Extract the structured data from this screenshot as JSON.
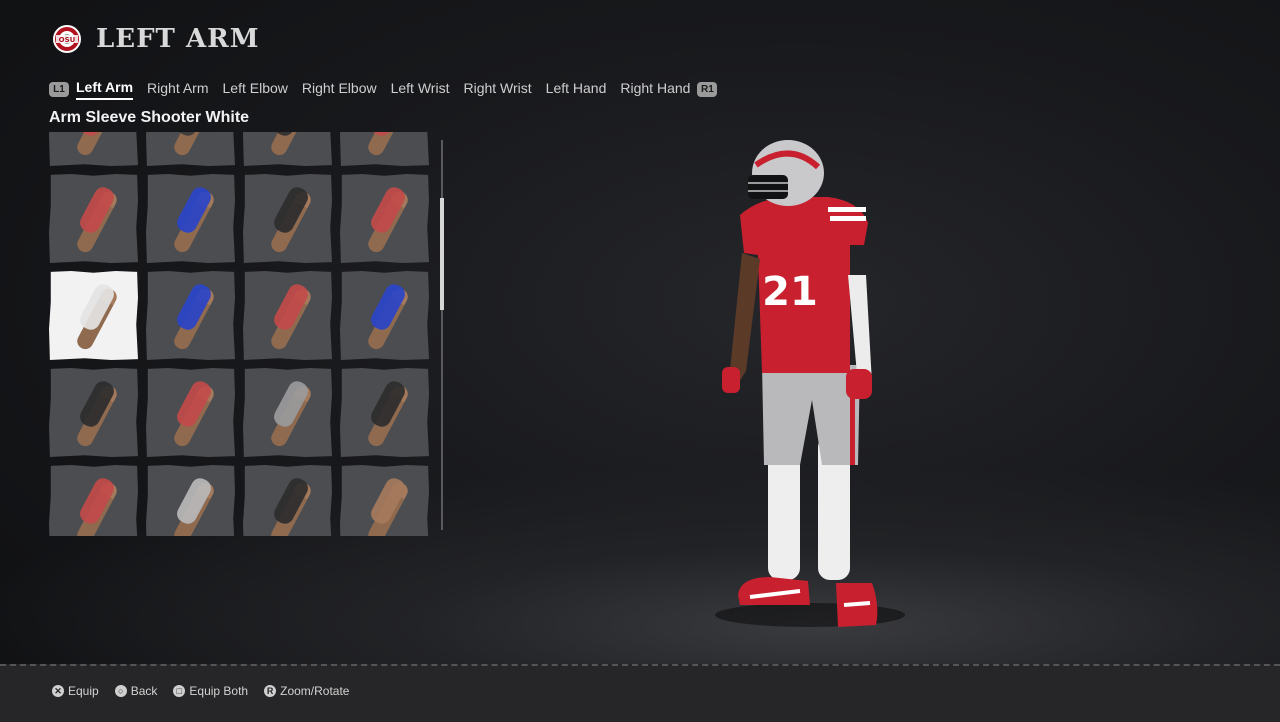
{
  "header": {
    "title": "LEFT ARM",
    "logo_icon": "ohio-state-logo"
  },
  "tabs": {
    "bumper_left": "L1",
    "bumper_right": "R1",
    "items": [
      {
        "label": "Left Arm",
        "active": true
      },
      {
        "label": "Right Arm",
        "active": false
      },
      {
        "label": "Left Elbow",
        "active": false
      },
      {
        "label": "Right Elbow",
        "active": false
      },
      {
        "label": "Left Wrist",
        "active": false
      },
      {
        "label": "Right Wrist",
        "active": false
      },
      {
        "label": "Left Hand",
        "active": false
      },
      {
        "label": "Right Hand",
        "active": false
      }
    ]
  },
  "selected_item": {
    "name": "Arm Sleeve Shooter White"
  },
  "gear_grid": {
    "selected_index": 8,
    "tiles": [
      {
        "color": "#c24a4a"
      },
      {
        "color": "#3a3a3c"
      },
      {
        "color": "#2f2f31"
      },
      {
        "color": "#c24a4a"
      },
      {
        "color": "#c24a4a"
      },
      {
        "color": "#2a44c8"
      },
      {
        "color": "#2c2c2e"
      },
      {
        "color": "#c24a4a"
      },
      {
        "color": "#e4e4e4"
      },
      {
        "color": "#2a44c8"
      },
      {
        "color": "#c24a4a"
      },
      {
        "color": "#2a44c8"
      },
      {
        "color": "#2c2c2e"
      },
      {
        "color": "#c24a4a"
      },
      {
        "color": "#9a9a9c"
      },
      {
        "color": "#2c2c2e"
      },
      {
        "color": "#c24a4a"
      },
      {
        "color": "#b8b8ba"
      },
      {
        "color": "#2c2c2e"
      },
      {
        "color": "#a57a5c"
      }
    ]
  },
  "player": {
    "jersey_number": "21",
    "jersey_color": "#c8202f",
    "pants_color": "#b9b9bb"
  },
  "footer": {
    "hints": [
      {
        "button_icon": "cross-button-icon",
        "label": "Equip"
      },
      {
        "button_icon": "circle-button-icon",
        "label": "Back"
      },
      {
        "button_icon": "square-button-icon",
        "label": "Equip Both"
      },
      {
        "button_icon": "rstick-button-icon",
        "label": "Zoom/Rotate"
      }
    ]
  }
}
